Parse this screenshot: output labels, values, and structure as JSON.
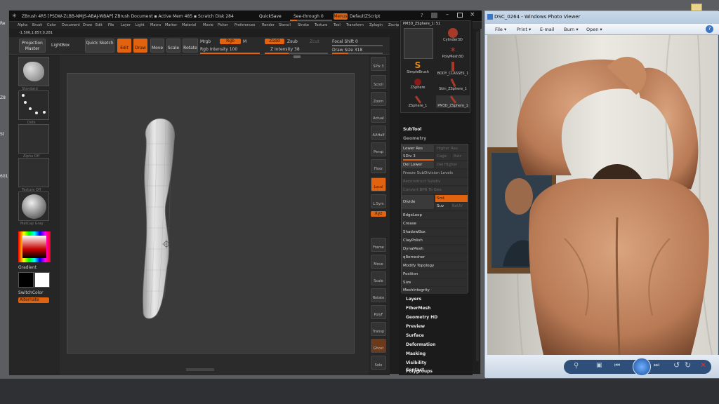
{
  "zbrush": {
    "title_text": "ZBrush 4R5  [PSDW-ZLBB-NMJS-ABAJ-WBAP]   ZBrush Document      ▪ Active Mem 485 ▪ Scratch Disk 284",
    "quicksave": "QuickSave",
    "seethrough": "See-through  0",
    "menus_label": "Menus",
    "default_script": "DefaultZScript",
    "menu_items": [
      "Alpha",
      "Brush",
      "Color",
      "Document",
      "Draw",
      "Edit",
      "File",
      "Layer",
      "Light",
      "Macro",
      "Marker",
      "Material",
      "Movie",
      "Picker",
      "Preferences",
      "Render",
      "Stencil",
      "Stroke",
      "Texture",
      "Tool",
      "Transform",
      "Zplugin",
      "Zscript"
    ],
    "coords": "-1.506,1.857,0.281",
    "shelf": {
      "projection_master": "Projection Master",
      "lightbox": "LightBox",
      "quick_sketch": "Quick Sketch",
      "edit": "Edit",
      "draw": "Draw",
      "move": "Move",
      "scale": "Scale",
      "rotate": "Rotate",
      "mrgb": "Mrgb",
      "rgb": "Rgb",
      "m": "M",
      "rgb_intensity": "Rgb Intensity 100",
      "zadd": "Zadd",
      "zsub": "Zsub",
      "zcut": "Zcut",
      "z_intensity": "Z Intensity 38",
      "focal_shift": "Focal Shift 0",
      "draw_size": "Draw Size 318",
      "rgb_intensity_value": 100,
      "z_intensity_value": 38,
      "draw_size_value": 318
    },
    "left_tray": {
      "brush_label": "Standard",
      "stroke_label": "Dots",
      "alpha_label": "Alpha Off",
      "texture_label": "Texture Off",
      "material_label": "MatCap Gray",
      "gradient": "Gradient",
      "switch_color": "SwitchColor",
      "alternate": "Alternate"
    },
    "right_shelf": [
      "SPix 3",
      "Scroll",
      "Zoom",
      "Actual",
      "AAHalf",
      "Persp",
      "Floor",
      "Local",
      "L.Sym",
      "Xyz",
      "Frame",
      "Move",
      "Scale",
      "Rotate",
      "PolyF",
      "Transp",
      "Ghost",
      "Solo"
    ],
    "tool_panel": {
      "current_tool": "PM3D_ZSphere_1: 51",
      "palette_items": [
        "PM3D_ZSphere",
        "Cylinder3D",
        "SimpleBrush",
        "PolyMesh3D",
        "BODY_CLASSES_1",
        "ZSphere",
        "Skin_ZSphere_1",
        "ZSphere_1",
        "PM3D_ZSphere_1"
      ],
      "subtool": "SubTool",
      "geometry": "Geometry",
      "lower_res": "Lower Res",
      "higher_res": "Higher Res",
      "sdiv": "SDiv 3",
      "cage": "Cage",
      "rstr": "Rstr",
      "del_lower": "Del Lower",
      "del_higher": "Del Higher",
      "freeze": "Freeze SubDivision Levels",
      "reconstruct": "Reconstruct Subdiv",
      "convert_bpr": "Convert BPR To Geo",
      "divide": "Divide",
      "smt": "Smt",
      "suv": "Suv",
      "reuv": "ReUV",
      "geometry_items": [
        "EdgeLoop",
        "Crease",
        "ShadowBox",
        "ClayPolish",
        "DynaMesh",
        "qRemesher",
        "Modify Topology",
        "Position",
        "Size",
        "MeshIntegrity"
      ],
      "sections": [
        "Layers",
        "FiberMesh",
        "Geometry HD",
        "Preview",
        "Surface",
        "Deformation",
        "Masking",
        "Visibility",
        "Polygroups",
        "Contact"
      ]
    }
  },
  "photo_viewer": {
    "title": "DSC_0264 - Windows Photo Viewer",
    "menu": [
      "File ▾",
      "Print ▾",
      "E-mail",
      "Burn ▾",
      "Open ▾"
    ]
  },
  "desktop": {
    "icon_letters": [
      "Re",
      "Z8",
      "St",
      "601"
    ]
  },
  "colors": {
    "accent": "#e1630f",
    "zbrush_bg": "#1e1e1e",
    "viewer_chrome": "#dde6f1"
  }
}
